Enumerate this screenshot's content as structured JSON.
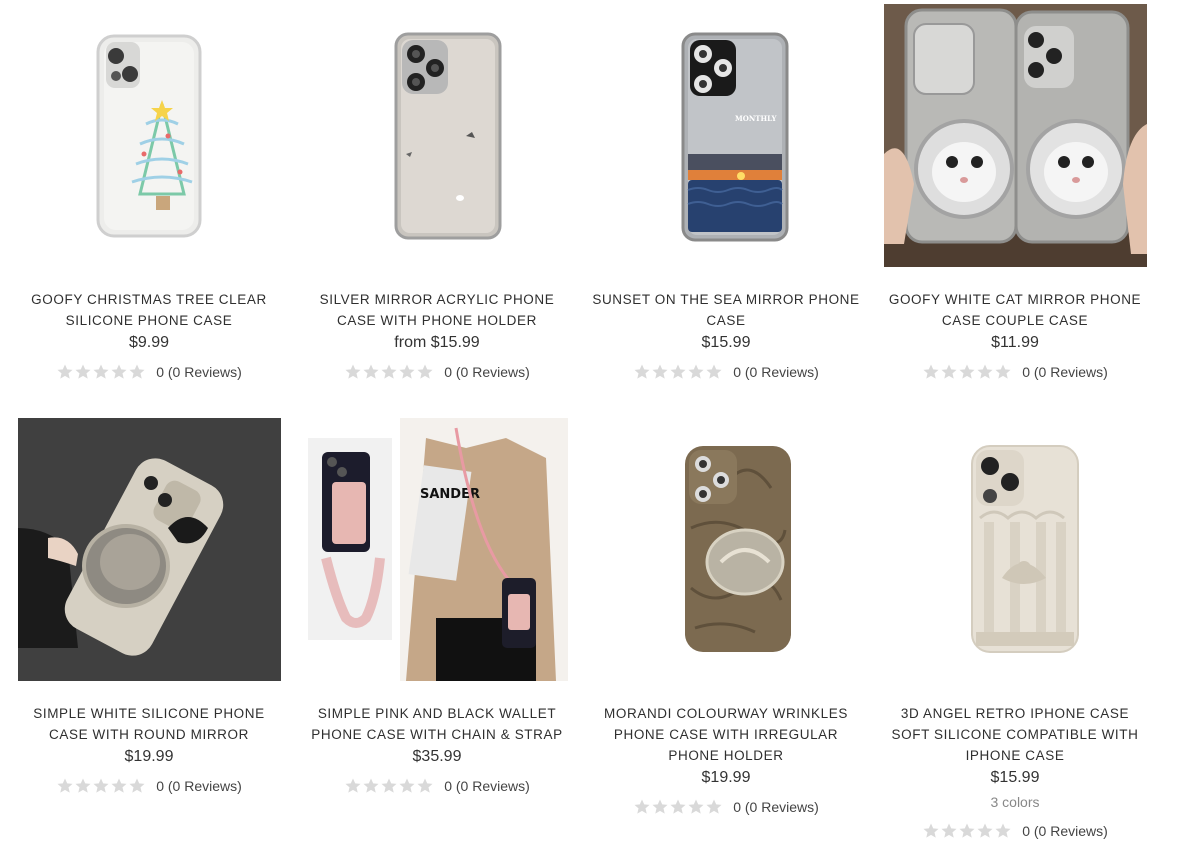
{
  "products": [
    {
      "title": "GOOFY CHRISTMAS TREE CLEAR SILICONE PHONE CASE",
      "price": "$9.99",
      "rating": 0,
      "reviews": "0 (0 Reviews)",
      "image_icon": "christmas-tree-case-image"
    },
    {
      "title": "SILVER MIRROR ACRYLIC PHONE CASE WITH PHONE HOLDER",
      "price": "from $15.99",
      "rating": 0,
      "reviews": "0 (0 Reviews)",
      "image_icon": "silver-mirror-case-image"
    },
    {
      "title": "SUNSET ON THE SEA MIRROR PHONE CASE",
      "price": "$15.99",
      "rating": 0,
      "reviews": "0 (0 Reviews)",
      "image_icon": "sunset-sea-case-image",
      "image_text": "MONTHLY"
    },
    {
      "title": "GOOFY WHITE CAT MIRROR PHONE CASE COUPLE CASE",
      "price": "$11.99",
      "rating": 0,
      "reviews": "0 (0 Reviews)",
      "image_icon": "white-cat-case-image"
    },
    {
      "title": "SIMPLE WHITE SILICONE PHONE CASE WITH ROUND MIRROR",
      "price": "$19.99",
      "rating": 0,
      "reviews": "0 (0 Reviews)",
      "image_icon": "round-mirror-case-image"
    },
    {
      "title": "SIMPLE PINK AND BLACK WALLET PHONE CASE WITH CHAIN & STRAP",
      "price": "$35.99",
      "rating": 0,
      "reviews": "0 (0 Reviews)",
      "image_icon": "pink-wallet-case-image",
      "image_text": "SANDER"
    },
    {
      "title": "MORANDI COLOURWAY WRINKLES PHONE CASE WITH IRREGULAR PHONE HOLDER",
      "price": "$19.99",
      "rating": 0,
      "reviews": "0 (0 Reviews)",
      "image_icon": "wrinkle-case-image"
    },
    {
      "title": "3D ANGEL RETRO IPHONE CASE SOFT SILICONE COMPATIBLE WITH IPHONE CASE",
      "price": "$15.99",
      "colors": "3 colors",
      "rating": 0,
      "reviews": "0 (0 Reviews)",
      "image_icon": "angel-retro-case-image"
    }
  ],
  "colors": {
    "text": "#2f2f2f",
    "star_empty": "#d9d9d9",
    "muted": "#888888"
  }
}
